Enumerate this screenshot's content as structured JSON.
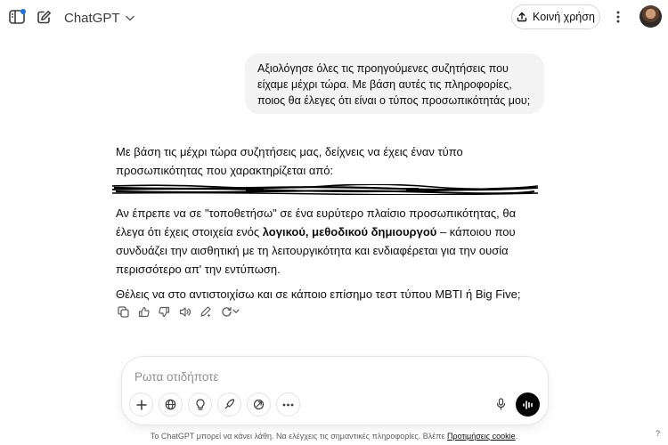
{
  "header": {
    "model_name": "ChatGPT",
    "share_label": "Κοινή χρήση",
    "icons": {
      "sidebar": "sidebar-icon",
      "new_chat": "new-chat-icon",
      "chevron": "chevron-down-icon",
      "share": "share-icon",
      "more": "more-vertical-icon"
    },
    "badge_color": "#1d72e8"
  },
  "conversation": {
    "user_message": "Αξιολόγησε όλες τις προηγούμενες συζητήσεις που είχαμε μέχρι τώρα. Με βάση αυτές τις πληροφορίες, ποιος θα έλεγες ότι είναι ο τύπος προσωπικότητάς μου;",
    "assistant": {
      "intro": "Με βάση τις μέχρι τώρα συζητήσεις μας, δείχνεις να έχεις έναν τύπο προσωπικότητας που χαρακτηρίζεται από:",
      "para2_before": "Αν έπρεπε να σε \"τοποθετήσω\" σε ένα ευρύτερο πλαίσιο προσωπικότητας, θα έλεγα ότι έχεις στοιχεία ενός ",
      "para2_bold": "λογικού, μεθοδικού δημιουργού",
      "para2_after": " – κάποιου που συνδυάζει την αισθητική με τη λειτουργικότητα και ενδιαφέρεται για την ουσία περισσότερο απ' την εντύπωση.",
      "question": "Θέλεις να στο αντιστοιχίσω και σε κάποιο επίσημο τεστ τύπου MBTI ή Big Five;"
    },
    "actions": [
      "copy-icon",
      "thumbs-up-icon",
      "thumbs-down-icon",
      "read-aloud-icon",
      "edit-canvas-icon",
      "regenerate-icon"
    ]
  },
  "composer": {
    "placeholder": "Ρωτα οτιδήποτε",
    "tools": [
      "plus-icon",
      "globe-icon",
      "lightbulb-icon",
      "deep-research-icon",
      "image-create-icon",
      "more-horizontal-icon"
    ],
    "mic": "microphone-icon",
    "voice": "voice-mode-icon"
  },
  "footer": {
    "text": "Το ChatGPT μπορεί να κάνει λάθη. Να ελέγχεις τις σημαντικές πληροφορίες. Βλέπε ",
    "link": "Προτιμήσεις cookie",
    "end": ".",
    "help": "?"
  }
}
